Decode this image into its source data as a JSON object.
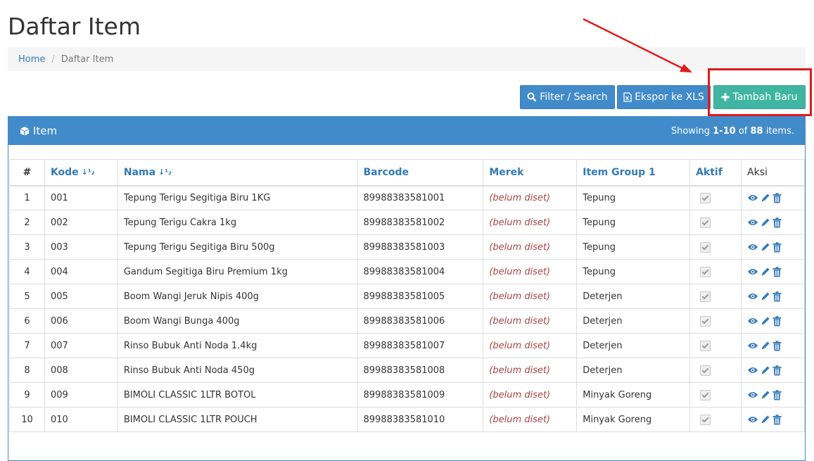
{
  "page": {
    "title": "Daftar Item"
  },
  "breadcrumb": {
    "home": "Home",
    "current": "Daftar Item"
  },
  "toolbar": {
    "filter_label": "Filter / Search",
    "export_label": "Ekspor ke XLS",
    "add_label": "Tambah Baru"
  },
  "panel": {
    "title": "Item",
    "summary_prefix": "Showing ",
    "summary_range": "1-10",
    "summary_mid": " of ",
    "summary_total": "88",
    "summary_suffix": " items."
  },
  "table": {
    "headers": {
      "no": "#",
      "kode": "Kode",
      "nama": "Nama",
      "barcode": "Barcode",
      "merek": "Merek",
      "group": "Item Group 1",
      "aktif": "Aktif",
      "aksi": "Aksi"
    },
    "rows": [
      {
        "no": "1",
        "kode": "001",
        "nama": "Tepung Terigu Segitiga Biru 1KG",
        "barcode": "89988383581001",
        "merek": "(belum diset)",
        "group": "Tepung"
      },
      {
        "no": "2",
        "kode": "002",
        "nama": "Tepung Terigu Cakra 1kg",
        "barcode": "89988383581002",
        "merek": "(belum diset)",
        "group": "Tepung"
      },
      {
        "no": "3",
        "kode": "003",
        "nama": "Tepung Terigu Segitiga Biru 500g",
        "barcode": "89988383581003",
        "merek": "(belum diset)",
        "group": "Tepung"
      },
      {
        "no": "4",
        "kode": "004",
        "nama": "Gandum Segitiga Biru Premium 1kg",
        "barcode": "89988383581004",
        "merek": "(belum diset)",
        "group": "Tepung"
      },
      {
        "no": "5",
        "kode": "005",
        "nama": "Boom Wangi Jeruk Nipis 400g",
        "barcode": "89988383581005",
        "merek": "(belum diset)",
        "group": "Deterjen"
      },
      {
        "no": "6",
        "kode": "006",
        "nama": "Boom Wangi Bunga 400g",
        "barcode": "89988383581006",
        "merek": "(belum diset)",
        "group": "Deterjen"
      },
      {
        "no": "7",
        "kode": "007",
        "nama": "Rinso Bubuk Anti Noda 1.4kg",
        "barcode": "89988383581007",
        "merek": "(belum diset)",
        "group": "Deterjen"
      },
      {
        "no": "8",
        "kode": "008",
        "nama": "Rinso Bubuk Anti Noda 450g",
        "barcode": "89988383581008",
        "merek": "(belum diset)",
        "group": "Deterjen"
      },
      {
        "no": "9",
        "kode": "009",
        "nama": "BIMOLI CLASSIC 1LTR BOTOL",
        "barcode": "89988383581009",
        "merek": "(belum diset)",
        "group": "Minyak Goreng"
      },
      {
        "no": "10",
        "kode": "010",
        "nama": "BIMOLI CLASSIC 1LTR POUCH",
        "barcode": "89988383581010",
        "merek": "(belum diset)",
        "group": "Minyak Goreng"
      }
    ]
  },
  "icons": {
    "filter": "search-icon",
    "export": "file-excel-icon",
    "add": "plus-icon",
    "panel": "cube-icon",
    "sort": "sort-numeric-icon",
    "view": "eye-icon",
    "edit": "pencil-icon",
    "delete": "trash-icon"
  },
  "colors": {
    "primary": "#428bca",
    "success": "#3fb5a2",
    "annotation": "#e01b1b",
    "unset_text": "#a94442"
  }
}
